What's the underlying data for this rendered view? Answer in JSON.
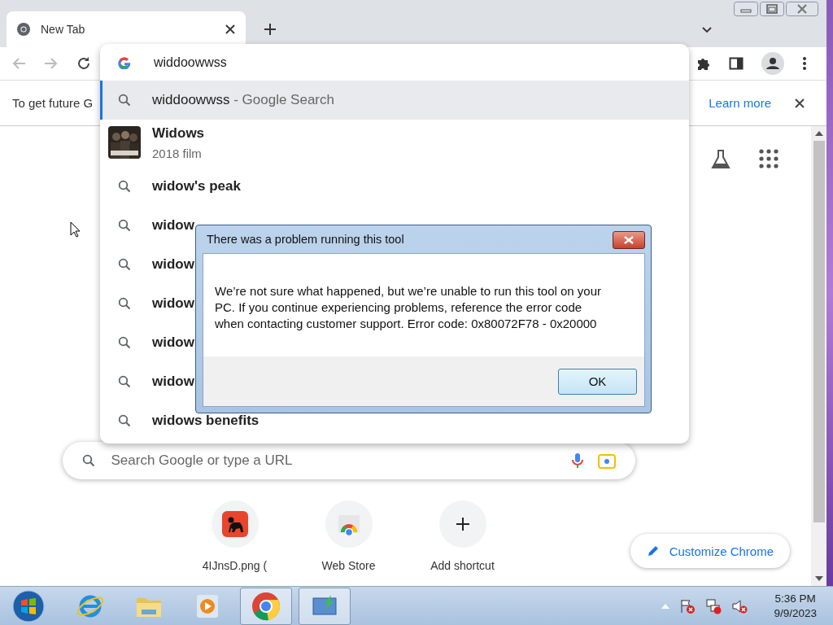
{
  "tabs": [
    {
      "title": "New Tab",
      "selected": true
    }
  ],
  "omnibox": {
    "value": "widdoowwss"
  },
  "suggestions": [
    {
      "kind": "search",
      "text": "widdoowwss",
      "suffix": " - Google Search",
      "selected": true
    },
    {
      "kind": "entity",
      "text": "Widows",
      "subtitle": "2018 film",
      "selected": false
    },
    {
      "kind": "search",
      "text": "widow's peak",
      "selected": false
    },
    {
      "kind": "search",
      "text": "widow",
      "selected": false
    },
    {
      "kind": "search",
      "text": "widow",
      "selected": false
    },
    {
      "kind": "search",
      "text": "widow",
      "selected": false
    },
    {
      "kind": "search",
      "text": "widow",
      "selected": false
    },
    {
      "kind": "search",
      "text": "widow",
      "selected": false
    },
    {
      "kind": "search",
      "text": "widows benefits",
      "selected": false
    }
  ],
  "infobar": {
    "message": "To get future G",
    "link": "Learn more"
  },
  "search_box": {
    "placeholder": "Search Google or type a URL"
  },
  "shortcuts": [
    {
      "kind": "site",
      "label": "4IJnsD.png ("
    },
    {
      "kind": "store",
      "label": "Web Store"
    },
    {
      "kind": "add",
      "label": "Add shortcut"
    }
  ],
  "customize_button": "Customize Chrome",
  "dialog": {
    "title": "There was a problem running this tool",
    "message": "We’re not sure what happened, but we’re unable to run this tool on your PC. If you continue experiencing problems, reference the error code when contacting customer support. Error code: 0x80072F78 - 0x20000",
    "button": "OK"
  },
  "taskbar": {
    "apps": [
      {
        "kind": "ie",
        "active": false
      },
      {
        "kind": "folder",
        "active": false
      },
      {
        "kind": "media",
        "active": false
      },
      {
        "kind": "chrome",
        "active": true
      },
      {
        "kind": "tool",
        "active": true
      }
    ],
    "time": "5:36 PM",
    "date": "9/9/2023"
  }
}
